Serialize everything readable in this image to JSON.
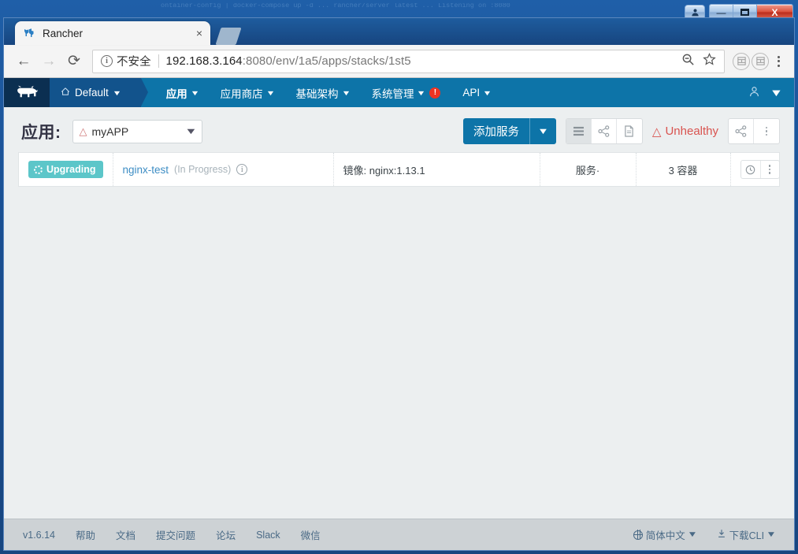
{
  "os": {
    "ghost_text": "ontainer-config  |  docker-compose  up  -d  ...  rancher/server  latest  ...  Listening  on  :8080",
    "window_buttons": {
      "user": "user-icon",
      "minimize": "—",
      "maximize": "❐",
      "close": "X"
    }
  },
  "browser": {
    "tab": {
      "title": "Rancher",
      "close": "×",
      "favicon": "rancher-logo-icon"
    },
    "nav": {
      "back": "←",
      "forward": "→",
      "reload": "⟳"
    },
    "omnibox": {
      "security_glyph": "i",
      "security_label": "不安全",
      "url_host": "192.168.3.164",
      "url_rest": ":8080/env/1a5/apps/stacks/1st5",
      "zoom_icon": "zoom-out-icon",
      "star_icon": "☆"
    },
    "extensions": [
      "extension-icon-1",
      "extension-icon-2"
    ],
    "menu": "chrome-menu-icon"
  },
  "rancher_nav": {
    "logo": "rancher-cow-logo",
    "environment": "Default",
    "items": [
      {
        "label": "应用",
        "active": true,
        "alert": false
      },
      {
        "label": "应用商店",
        "active": false,
        "alert": false
      },
      {
        "label": "基础架构",
        "active": false,
        "alert": false
      },
      {
        "label": "系统管理",
        "active": false,
        "alert": true
      },
      {
        "label": "API",
        "active": false,
        "alert": false
      }
    ],
    "alert_glyph": "!",
    "user_icon": "user-account-icon",
    "user_caret": "⌄"
  },
  "page_header": {
    "title": "应用:",
    "stack_name": "myAPP",
    "stack_warning_icon": "warning-triangle-icon",
    "add_service_label": "添加服务",
    "view_icons": [
      "list-view-icon",
      "graph-view-icon",
      "file-view-icon"
    ],
    "selected_view": 0,
    "health_status": "Unhealthy",
    "health_icon": "warning-triangle-icon",
    "share_icon": "share-graph-icon",
    "more_icon": "more-vertical-icon"
  },
  "table": {
    "rows": [
      {
        "state_badge": "Upgrading",
        "state_icon": "spinner-icon",
        "name": "nginx-test",
        "name_status": "(In Progress)",
        "info_icon": "info-icon",
        "image": "镜像: nginx:1.13.1",
        "service": "服务·",
        "containers": "3 容器",
        "actions": [
          "history-clock-icon",
          "more-vertical-icon"
        ]
      }
    ]
  },
  "footer": {
    "version": "v1.6.14",
    "links": [
      "帮助",
      "文档",
      "提交问题",
      "论坛",
      "Slack",
      "微信"
    ],
    "language": "简体中文",
    "download_cli": "下载CLI",
    "globe_icon": "globe-icon",
    "download_icon": "download-icon",
    "caret": "⌄"
  },
  "colors": {
    "rancher_blue": "#0d74a8",
    "env_blue": "#12538c",
    "logo_dark": "#0b2f51",
    "badge_teal": "#5cc6c9",
    "unhealthy_red": "#d9534f",
    "link_blue": "#3d8dc4",
    "footer_gray": "#cdd2d5",
    "content_bg": "#eceff0"
  }
}
